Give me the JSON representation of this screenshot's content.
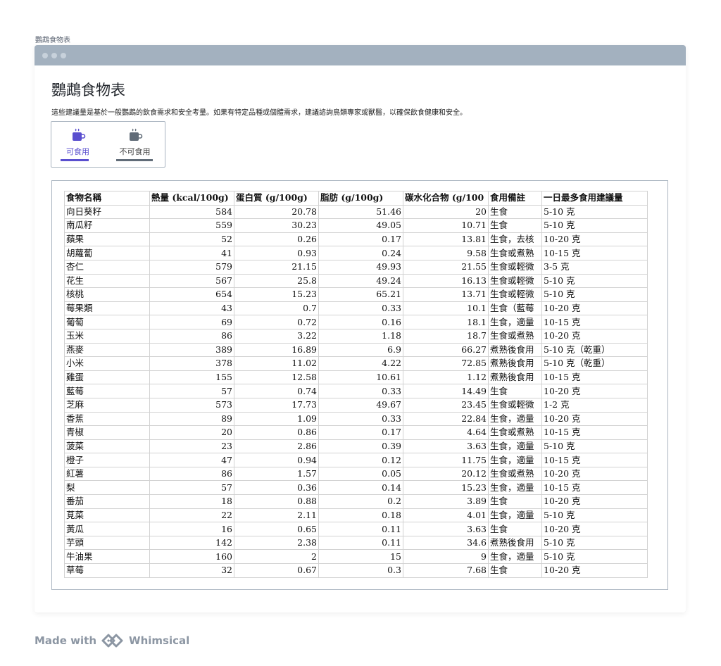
{
  "page_label": "鸚鵡食物表",
  "app": {
    "title": "鸚鵡食物表",
    "description": "這些建議量是基於一般鸚鵡的飲食需求和安全考量。如果有特定品種或個體需求，建議諮詢鳥類專家或獸醫，以確保飲食健康和安全。"
  },
  "tabs": [
    {
      "label": "可食用",
      "icon": "cup-icon",
      "active": true
    },
    {
      "label": "不可食用",
      "icon": "cup-icon",
      "active": false
    }
  ],
  "table": {
    "headers": [
      "食物名稱",
      "熱量 (kcal/100g)",
      "蛋白質 (g/100g)",
      "脂肪 (g/100g)",
      "碳水化合物 (g/100",
      "食用備註",
      "一日最多食用建議量"
    ],
    "rows": [
      [
        "向日葵籽",
        "584",
        "20.78",
        "51.46",
        "20",
        "生食",
        "5-10 克"
      ],
      [
        "南瓜籽",
        "559",
        "30.23",
        "49.05",
        "10.71",
        "生食",
        "5-10 克"
      ],
      [
        "蘋果",
        "52",
        "0.26",
        "0.17",
        "13.81",
        "生食，去核",
        "10-20 克"
      ],
      [
        "胡蘿蔔",
        "41",
        "0.93",
        "0.24",
        "9.58",
        "生食或煮熟",
        "10-15 克"
      ],
      [
        "杏仁",
        "579",
        "21.15",
        "49.93",
        "21.55",
        "生食或輕微",
        "3-5 克"
      ],
      [
        "花生",
        "567",
        "25.8",
        "49.24",
        "16.13",
        "生食或輕微",
        "5-10 克"
      ],
      [
        "核桃",
        "654",
        "15.23",
        "65.21",
        "13.71",
        "生食或輕微",
        "5-10 克"
      ],
      [
        "莓果類",
        "43",
        "0.7",
        "0.33",
        "10.1",
        "生食（藍莓",
        "10-20 克"
      ],
      [
        "葡萄",
        "69",
        "0.72",
        "0.16",
        "18.1",
        "生食，適量",
        "10-15 克"
      ],
      [
        "玉米",
        "86",
        "3.22",
        "1.18",
        "18.7",
        "生食或煮熟",
        "10-20 克"
      ],
      [
        "燕麥",
        "389",
        "16.89",
        "6.9",
        "66.27",
        "煮熟後食用",
        "5-10 克（乾重）"
      ],
      [
        "小米",
        "378",
        "11.02",
        "4.22",
        "72.85",
        "煮熟後食用",
        "5-10 克（乾重）"
      ],
      [
        "雞蛋",
        "155",
        "12.58",
        "10.61",
        "1.12",
        "煮熟後食用",
        "10-15 克"
      ],
      [
        "藍莓",
        "57",
        "0.74",
        "0.33",
        "14.49",
        "生食",
        "10-20 克"
      ],
      [
        "芝麻",
        "573",
        "17.73",
        "49.67",
        "23.45",
        "生食或輕微",
        "1-2 克"
      ],
      [
        "香蕉",
        "89",
        "1.09",
        "0.33",
        "22.84",
        "生食，適量",
        "10-20 克"
      ],
      [
        "青椒",
        "20",
        "0.86",
        "0.17",
        "4.64",
        "生食或煮熟",
        "10-15 克"
      ],
      [
        "菠菜",
        "23",
        "2.86",
        "0.39",
        "3.63",
        "生食，適量",
        "5-10 克"
      ],
      [
        "橙子",
        "47",
        "0.94",
        "0.12",
        "11.75",
        "生食，適量",
        "10-15 克"
      ],
      [
        "紅薯",
        "86",
        "1.57",
        "0.05",
        "20.12",
        "生食或煮熟",
        "10-20 克"
      ],
      [
        "梨",
        "57",
        "0.36",
        "0.14",
        "15.23",
        "生食，適量",
        "10-15 克"
      ],
      [
        "番茄",
        "18",
        "0.88",
        "0.2",
        "3.89",
        "生食",
        "10-20 克"
      ],
      [
        "莧菜",
        "22",
        "2.11",
        "0.18",
        "4.01",
        "生食，適量",
        "5-10 克"
      ],
      [
        "黃瓜",
        "16",
        "0.65",
        "0.11",
        "3.63",
        "生食",
        "10-20 克"
      ],
      [
        "芋頭",
        "142",
        "2.38",
        "0.11",
        "34.6",
        "煮熟後食用",
        "5-10 克"
      ],
      [
        "牛油果",
        "160",
        "2",
        "15",
        "9",
        "生食，適量",
        "5-10 克"
      ],
      [
        "草莓",
        "32",
        "0.67",
        "0.3",
        "7.68",
        "生食",
        "10-20 克"
      ]
    ]
  },
  "footer": {
    "made_with": "Made with",
    "brand": "Whimsical",
    "brand_icon": "whimsical-logo-icon"
  },
  "colors": {
    "titlebar": "#a3b1bf",
    "accent": "#5a4fcf",
    "inactive": "#616c78"
  }
}
